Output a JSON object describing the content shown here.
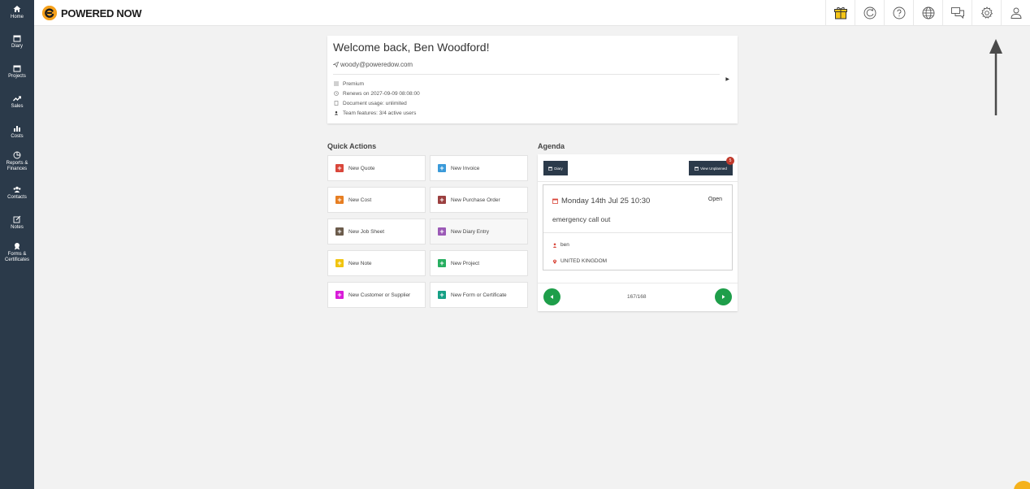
{
  "app": {
    "brand": "POWERED NOW"
  },
  "sidebar": {
    "items": [
      {
        "label": "Home",
        "icon": "home-icon"
      },
      {
        "label": "Diary",
        "icon": "calendar-icon"
      },
      {
        "label": "Projects",
        "icon": "folder-icon"
      },
      {
        "label": "Sales",
        "icon": "trending-up-icon"
      },
      {
        "label": "Costs",
        "icon": "bar-chart-icon"
      },
      {
        "label": "Reports &",
        "label2": "Finances",
        "icon": "pie-chart-icon"
      },
      {
        "label": "Contacts",
        "icon": "users-icon"
      },
      {
        "label": "Notes",
        "icon": "edit-icon"
      },
      {
        "label": "Forms &",
        "label2": "Certificates",
        "icon": "certificate-icon"
      }
    ]
  },
  "header": {
    "icons": [
      "gift-icon",
      "sync-icon",
      "help-icon",
      "globe-icon",
      "chat-icon",
      "settings-icon",
      "user-icon"
    ]
  },
  "welcome": {
    "title": "Welcome back, Ben Woodford!",
    "email": "woody@poweredow.com",
    "plan": "Premium",
    "renews": "Renews on 2027-09-09 08:08:00",
    "usage": "Document usage: unlimited",
    "team": "Team features: 3/4 active users"
  },
  "quick_actions": {
    "title": "Quick Actions",
    "items": [
      {
        "label": "New Quote",
        "color": "#d9463a"
      },
      {
        "label": "New Invoice",
        "color": "#3a9ad9"
      },
      {
        "label": "New Cost",
        "color": "#e67e22"
      },
      {
        "label": "New Purchase Order",
        "color": "#9b3f3f"
      },
      {
        "label": "New Job Sheet",
        "color": "#6b5b4b"
      },
      {
        "label": "New Diary Entry",
        "color": "#9b59b6"
      },
      {
        "label": "New Note",
        "color": "#f1c40f"
      },
      {
        "label": "New Project",
        "color": "#27ae60"
      },
      {
        "label": "New Customer or Supplier",
        "color": "#d81bd8"
      },
      {
        "label": "New Form or Certificate",
        "color": "#16a085"
      }
    ]
  },
  "agenda": {
    "title": "Agenda",
    "diary_btn": "Diary",
    "unplanned_btn": "View Unplanned",
    "unplanned_count": "5",
    "event": {
      "date": "Monday 14th Jul 25 10:30",
      "status": "Open",
      "title": "emergency call out",
      "assignee": "ben",
      "location": "UNITED KINGDOM"
    },
    "pager": "167/168"
  },
  "colors": {
    "sidebar": "#2b3a4a",
    "brand_orange": "#f5a11c",
    "pager_green": "#1e9e4a",
    "badge_red": "#c0392b"
  }
}
